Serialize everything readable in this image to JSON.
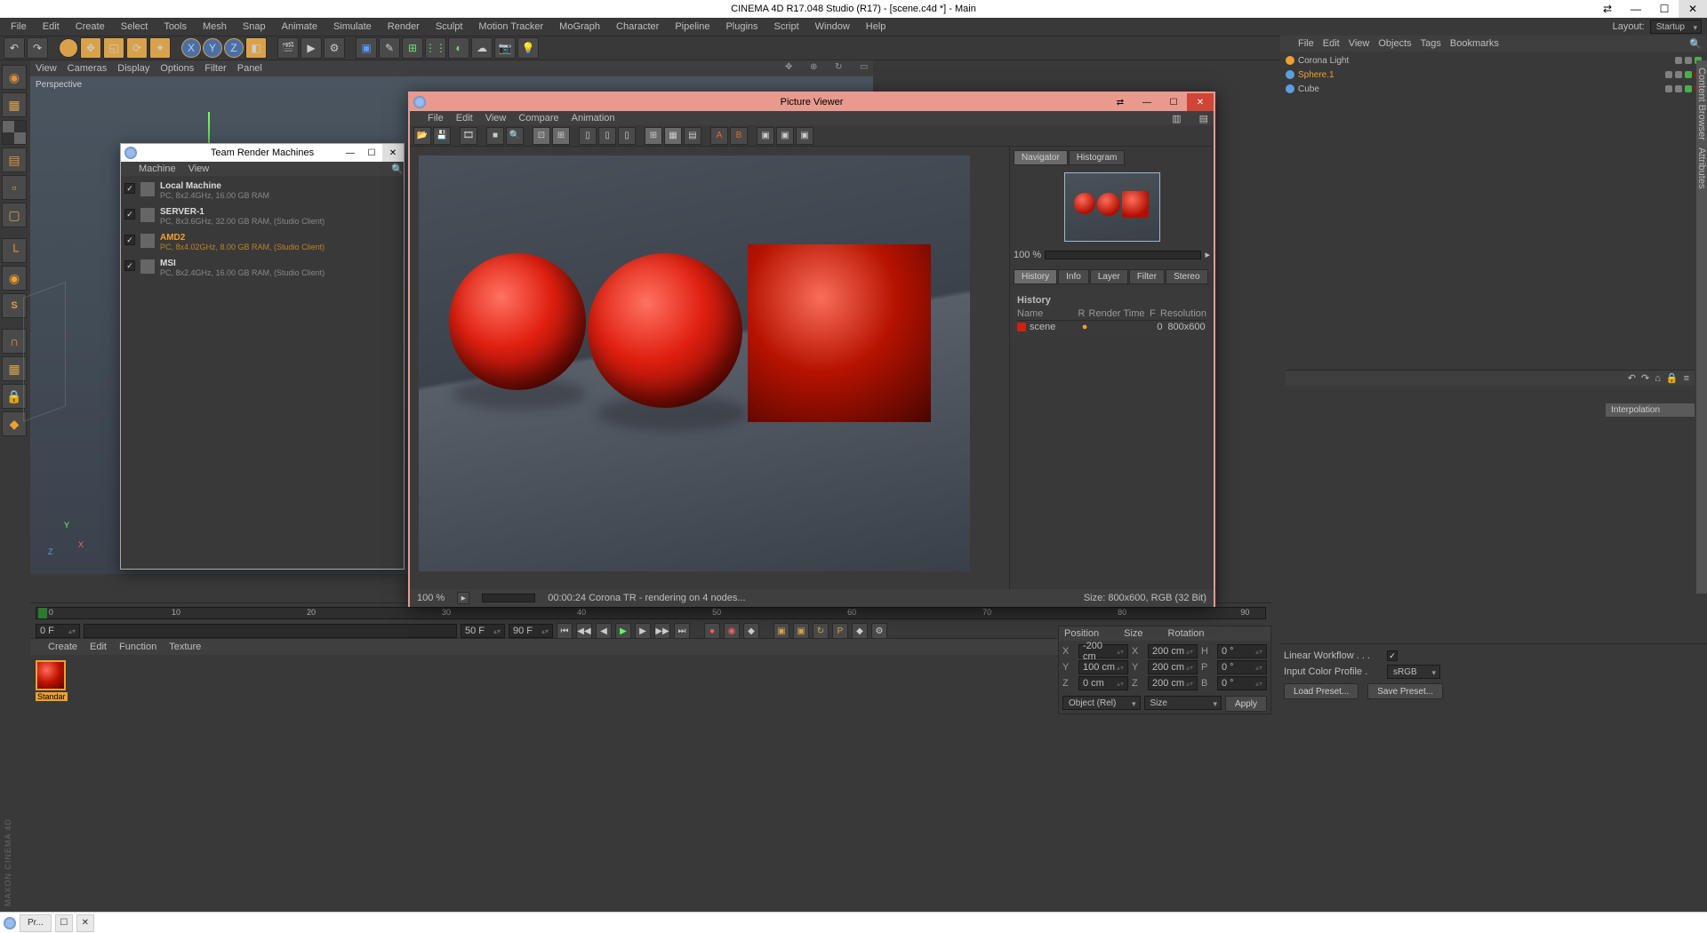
{
  "app_title": "CINEMA 4D R17.048 Studio (R17) - [scene.c4d *] - Main",
  "menubar": [
    "File",
    "Edit",
    "Create",
    "Select",
    "Tools",
    "Mesh",
    "Snap",
    "Animate",
    "Simulate",
    "Render",
    "Sculpt",
    "Motion Tracker",
    "MoGraph",
    "Character",
    "Pipeline",
    "Plugins",
    "Script",
    "Window",
    "Help"
  ],
  "layout_label": "Layout:",
  "layout_value": "Startup",
  "viewport": {
    "menu": [
      "View",
      "Cameras",
      "Display",
      "Options",
      "Filter",
      "Panel"
    ],
    "perspective": "Perspective"
  },
  "objects": {
    "menu": [
      "File",
      "Edit",
      "View",
      "Objects",
      "Tags",
      "Bookmarks"
    ],
    "items": [
      {
        "name": "Corona Light",
        "selected": false,
        "bullet": "#f0a030"
      },
      {
        "name": "Sphere.1",
        "selected": true,
        "bullet": "#5aa0e0"
      },
      {
        "name": "Cube",
        "selected": false,
        "bullet": "#5aa0e0"
      }
    ]
  },
  "timeline": {
    "ticks": [
      "0",
      "10",
      "20",
      "30",
      "40",
      "50",
      "60",
      "70",
      "80",
      "90"
    ],
    "frame_start": "0 F",
    "frame_end": "90 F",
    "frame_a": "50 F",
    "frame_b": "90 F"
  },
  "coord": {
    "headers": [
      "Position",
      "Size",
      "Rotation"
    ],
    "x": {
      "pos": "-200 cm",
      "size": "200 cm",
      "rot": "0 °"
    },
    "y": {
      "pos": "100 cm",
      "size": "200 cm",
      "rot": "0 °"
    },
    "z": {
      "pos": "0 cm",
      "size": "200 cm",
      "rot": "0 °"
    },
    "object_mode": "Object (Rel)",
    "size_mode": "Size",
    "apply": "Apply"
  },
  "attr": {
    "linear_workflow": "Linear Workflow . . .",
    "color_profile_label": "Input Color Profile .",
    "color_profile_value": "sRGB",
    "load_preset": "Load Preset...",
    "save_preset": "Save Preset...",
    "interpolation": "Interpolation"
  },
  "materials": {
    "menu": [
      "Create",
      "Edit",
      "Function",
      "Texture"
    ],
    "swatch": "Standar"
  },
  "team_render": {
    "title": "Team Render Machines",
    "menu": [
      "Machine",
      "View"
    ],
    "machines": [
      {
        "name": "Local Machine",
        "desc": "PC, 8x2.4GHz, 16.00 GB RAM",
        "selected": false
      },
      {
        "name": "SERVER-1",
        "desc": "PC, 8x3.6GHz, 32.00 GB RAM, (Studio Client)",
        "selected": false
      },
      {
        "name": "AMD2",
        "desc": "PC, 8x4.02GHz, 8.00 GB RAM, (Studio Client)",
        "selected": true
      },
      {
        "name": "MSI",
        "desc": "PC, 8x2.4GHz, 16.00 GB RAM, (Studio Client)",
        "selected": false
      }
    ]
  },
  "picture_viewer": {
    "title": "Picture Viewer",
    "menu": [
      "File",
      "Edit",
      "View",
      "Compare",
      "Animation"
    ],
    "nav_tabs": [
      "Navigator",
      "Histogram"
    ],
    "zoom": "100 %",
    "hist_tabs": [
      "History",
      "Info",
      "Layer",
      "Filter",
      "Stereo"
    ],
    "hist_title": "History",
    "hist_headers": [
      "Name",
      "R",
      "Render Time",
      "F",
      "Resolution"
    ],
    "hist_row": {
      "name": "scene",
      "r": "●",
      "time": "",
      "f": "0",
      "res": "800x600"
    },
    "status": {
      "zoom": "100 %",
      "time": "00:00:24 Corona TR - rendering on 4 nodes...",
      "size": "Size: 800x600, RGB (32 Bit)"
    }
  },
  "taskbar": {
    "item": "Pr..."
  },
  "maxon": "MAXON CINEMA 4D"
}
